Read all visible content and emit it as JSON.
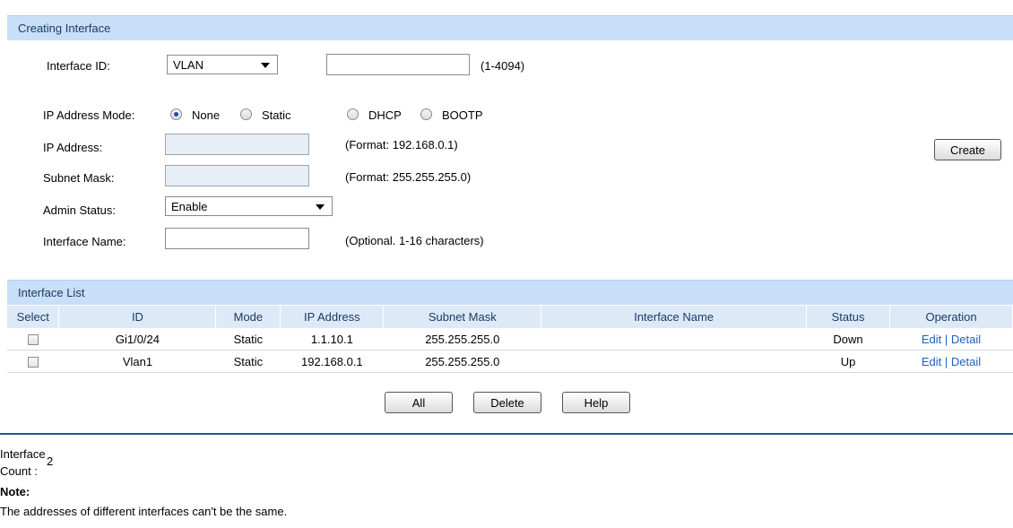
{
  "creating": {
    "title": "Creating Interface",
    "interface_id_label": "Interface ID:",
    "interface_type": "VLAN",
    "interface_id_value": "",
    "interface_id_hint": "(1-4094)",
    "ip_mode_label": "IP Address Mode:",
    "modes": [
      "None",
      "Static",
      "DHCP",
      "BOOTP"
    ],
    "selected_mode": "None",
    "ip_label": "IP Address:",
    "ip_value": "",
    "ip_hint": "(Format: 192.168.0.1)",
    "mask_label": "Subnet Mask:",
    "mask_value": "",
    "mask_hint": "(Format: 255.255.255.0)",
    "admin_label": "Admin Status:",
    "admin_value": "Enable",
    "name_label": "Interface Name:",
    "name_value": "",
    "name_hint": "(Optional. 1-16 characters)",
    "create_button": "Create"
  },
  "list": {
    "title": "Interface List",
    "columns": [
      "Select",
      "ID",
      "Mode",
      "IP Address",
      "Subnet Mask",
      "Interface Name",
      "Status",
      "Operation"
    ],
    "rows": [
      {
        "id": "Gi1/0/24",
        "mode": "Static",
        "ip": "1.1.10.1",
        "mask": "255.255.255.0",
        "name": "",
        "status": "Down",
        "edit": "Edit",
        "sep": "|",
        "detail": "Detail"
      },
      {
        "id": "Vlan1",
        "mode": "Static",
        "ip": "192.168.0.1",
        "mask": "255.255.255.0",
        "name": "",
        "status": "Up",
        "edit": "Edit",
        "sep": "|",
        "detail": "Detail"
      }
    ],
    "buttons": {
      "all": "All",
      "delete": "Delete",
      "help": "Help"
    }
  },
  "footer": {
    "count_label_line1": "Interface",
    "count_label_line2": "Count :",
    "count_value": "2",
    "note_title": "Note:",
    "note_text": "The addresses of different interfaces can't be the same."
  },
  "colors": {
    "header_bg": "#c9dff7",
    "link": "#1f5fbf",
    "rule": "#1f5a86"
  }
}
